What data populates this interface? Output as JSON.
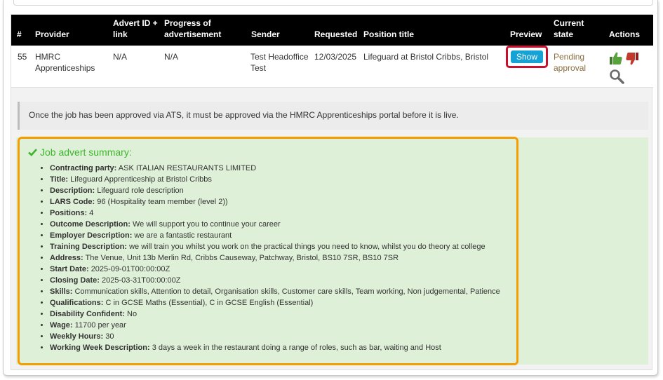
{
  "table": {
    "headers": {
      "num": "#",
      "provider": "Provider",
      "advert_line1": "Advert ID +",
      "advert_line2": "link",
      "progress_line1": "Progress of",
      "progress_line2": "advertisement",
      "sender": "Sender",
      "requested": "Requested",
      "position": "Position title",
      "preview": "Preview",
      "state_line1": "Current",
      "state_line2": "state",
      "actions": "Actions"
    },
    "row": {
      "num": "55",
      "provider_line1": "HMRC",
      "provider_line2": "Apprenticeships",
      "advert_id": "N/A",
      "progress": "N/A",
      "sender_line1": "Test Headoffice",
      "sender_line2": "Test",
      "requested": "12/03/2025",
      "position": "Lifeguard at Bristol Cribbs, Bristol",
      "preview_button": "Show",
      "state_line1": "Pending",
      "state_line2": "approval",
      "actions_icons": [
        "thumbs-up-icon",
        "thumbs-down-icon",
        "search-icon"
      ]
    }
  },
  "notice": "Once the job has been approved via ATS, it must be approved via the HMRC Apprenticeships portal before it is live.",
  "summary": {
    "title": "Job advert summary:",
    "items": [
      {
        "label": "Contracting party:",
        "value": "ASK ITALIAN RESTAURANTS LIMITED"
      },
      {
        "label": "Title:",
        "value": "Lifeguard Apprenticeship at Bristol Cribbs"
      },
      {
        "label": "Description:",
        "value": "Lifeguard role description"
      },
      {
        "label": "LARS Code:",
        "value": "96 (Hospitality team member (level 2))"
      },
      {
        "label": "Positions:",
        "value": "4"
      },
      {
        "label": "Outcome Description:",
        "value": "We will support you to continue your career"
      },
      {
        "label": "Employer Description:",
        "value": "we are a fantastic restaurant"
      },
      {
        "label": "Training Description:",
        "value": "we will train you whilst you work on the practical things you need to know, whilst you do theory at college"
      },
      {
        "label": "Address:",
        "value": "The Venue, Unit 13b Merlin Rd, Cribbs Causeway, Patchway, Bristol, BS10 7SR, BS10 7SR"
      },
      {
        "label": "Start Date:",
        "value": "2025-09-01T00:00:00Z"
      },
      {
        "label": "Closing Date:",
        "value": "2025-03-31T00:00:00Z"
      },
      {
        "label": "Skills:",
        "value": "Communication skills, Attention to detail, Organisation skills, Customer care skills, Team working, Non judgemental, Patience"
      },
      {
        "label": "Qualifications:",
        "value": "C in GCSE Maths (Essential), C in GCSE English (Essential)"
      },
      {
        "label": "Disability Confident:",
        "value": "No"
      },
      {
        "label": "Wage:",
        "value": "11700 per year"
      },
      {
        "label": "Weekly Hours:",
        "value": "30"
      },
      {
        "label": "Working Week Description:",
        "value": "3 days a week in the restaurant doing a range of roles, such as bar, waiting and Host"
      }
    ]
  },
  "colors": {
    "header_bg": "#000000",
    "show_button": "#17a2d6",
    "highlight_red": "#c8102e",
    "highlight_orange": "#f59c00",
    "summary_bg": "#dff0d8",
    "success_green": "#3cb52a",
    "pending": "#8a6d3b"
  }
}
